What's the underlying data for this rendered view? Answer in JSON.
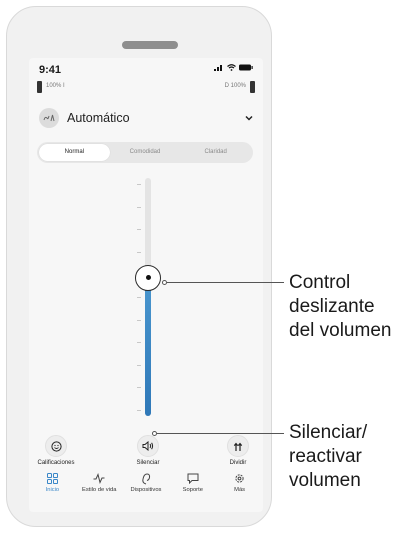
{
  "status_bar": {
    "time": "9:41"
  },
  "batteries": {
    "left_text": "100% I",
    "right_text": "D 100%"
  },
  "program": {
    "name": "Automático"
  },
  "tabs": [
    {
      "label": "Normal",
      "active": true
    },
    {
      "label": "Comodidad",
      "active": false
    },
    {
      "label": "Claridad",
      "active": false
    }
  ],
  "volume": {
    "level": 0.58
  },
  "actions": {
    "ratings": "Calificaciones",
    "mute": "Silenciar",
    "share": "Dividir"
  },
  "nav": [
    {
      "label": "Inicio",
      "icon": "home-grid-icon",
      "active": true
    },
    {
      "label": "Estilo de vida",
      "icon": "activity-icon",
      "active": false
    },
    {
      "label": "Dispositivos",
      "icon": "hearing-aid-icon",
      "active": false
    },
    {
      "label": "Soporte",
      "icon": "chat-bubble-icon",
      "active": false
    },
    {
      "label": "Más",
      "icon": "gear-icon",
      "active": false
    }
  ],
  "callouts": {
    "slider": [
      "Control",
      "deslizante",
      "del volumen"
    ],
    "mute": [
      "Silenciar/",
      "reactivar",
      "volumen"
    ]
  },
  "colors": {
    "accent": "#3a87c8",
    "fill_top": "#4a97cf",
    "fill_bottom": "#2f78b8"
  }
}
